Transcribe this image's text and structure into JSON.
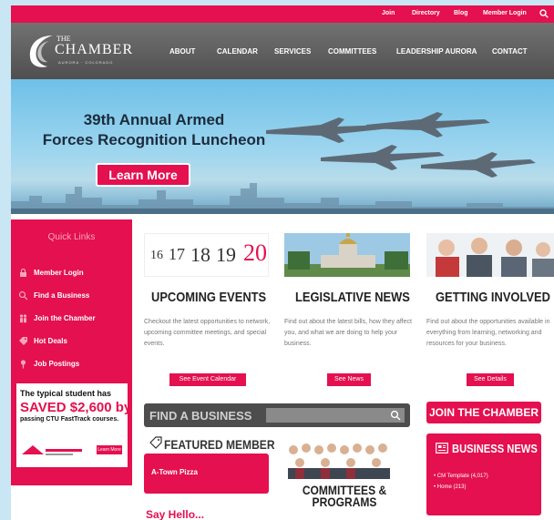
{
  "topbar": {
    "links": [
      "Join",
      "Directory",
      "Blog",
      "Member Login"
    ]
  },
  "logo": {
    "the": "THE",
    "name": "CHAMBER",
    "sub": "AURORA · COLORADO"
  },
  "nav": {
    "items": [
      "ABOUT",
      "CALENDAR",
      "SERVICES",
      "COMMITTEES",
      "LEADERSHIP AURORA",
      "CONTACT"
    ]
  },
  "hero": {
    "title_line1": "39th Annual Armed",
    "title_line2": "Forces Recognition Luncheon",
    "button": "Learn More"
  },
  "sidebar": {
    "title": "Quick Links",
    "links": [
      {
        "label": "Member Login",
        "icon": "lock-icon"
      },
      {
        "label": "Find a Business",
        "icon": "search-icon"
      },
      {
        "label": "Join the Chamber",
        "icon": "people-icon"
      },
      {
        "label": "Hot Deals",
        "icon": "tag-icon"
      },
      {
        "label": "Job Postings",
        "icon": "pin-icon"
      }
    ],
    "ad": {
      "line1": "The typical student has",
      "line2": "SAVED $2,600 by",
      "line3": "passing CTU FastTrack courses.",
      "button": "Learn More"
    }
  },
  "columns": [
    {
      "dates": [
        "16",
        "17",
        "18",
        "19",
        "20"
      ],
      "heading": "UPCOMING EVENTS",
      "text": "Checkout the latest opportunities to network, upcoming committee meetings, and special events.",
      "button": "See Event Calendar"
    },
    {
      "heading": "LEGISLATIVE NEWS",
      "text": "Find out about the latest bills, how they affect you, and what we are doing to help your business.",
      "button": "See News"
    },
    {
      "heading": "GETTING INVOLVED",
      "text": "Find out about the opportunities available in everything from learning, networking and resources for your business.",
      "button": "See Details"
    }
  ],
  "find": {
    "label": "FIND A BUSINESS",
    "value": ""
  },
  "join": {
    "label": "JOIN THE CHAMBER"
  },
  "featured": {
    "heading": "FEATURED MEMBER",
    "name": "A-Town Pizza"
  },
  "say": "Say Hello...",
  "committees": {
    "line1": "COMMITTEES &",
    "line2": "PROGRAMS"
  },
  "business_news": {
    "heading": "BUSINESS NEWS",
    "items": [
      "CM Template (4,017)",
      "Home (213)"
    ]
  },
  "colors": {
    "accent": "#e4104f",
    "nav": "#5f5f5f",
    "background": "#c9e6f5"
  }
}
